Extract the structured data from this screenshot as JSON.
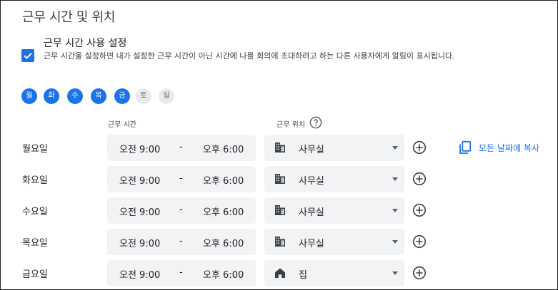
{
  "section": {
    "title": "근무 시간 및 위치"
  },
  "working_hours_toggle": {
    "checked": true,
    "label": "근무 시간 사용 설정",
    "description": "근무 시간을 설정하면 내가 설정한 근무 시간이 아닌 시간에 나를 회의에 초대하려고 하는 다른 사용자에게 알림이 표시됩니다."
  },
  "days": [
    {
      "label": "월",
      "selected": true
    },
    {
      "label": "화",
      "selected": true
    },
    {
      "label": "수",
      "selected": true
    },
    {
      "label": "목",
      "selected": true
    },
    {
      "label": "금",
      "selected": true
    },
    {
      "label": "토",
      "selected": false
    },
    {
      "label": "일",
      "selected": false
    }
  ],
  "columns": {
    "hours": "근무 시간",
    "location": "근무 위치"
  },
  "rows": [
    {
      "day": "월요일",
      "start": "오전 9:00",
      "sep": "-",
      "end": "오후 6:00",
      "location": "사무실",
      "location_icon": "office-building-icon"
    },
    {
      "day": "화요일",
      "start": "오전 9:00",
      "sep": "-",
      "end": "오후 6:00",
      "location": "사무실",
      "location_icon": "office-building-icon"
    },
    {
      "day": "수요일",
      "start": "오전 9:00",
      "sep": "-",
      "end": "오후 6:00",
      "location": "사무실",
      "location_icon": "office-building-icon"
    },
    {
      "day": "목요일",
      "start": "오전 9:00",
      "sep": "-",
      "end": "오후 6:00",
      "location": "사무실",
      "location_icon": "office-building-icon"
    },
    {
      "day": "금요일",
      "start": "오전 9:00",
      "sep": "-",
      "end": "오후 6:00",
      "location": "집",
      "location_icon": "home-icon"
    }
  ],
  "copy_all": {
    "label": "모든 날짜에 복사"
  },
  "colors": {
    "accent": "#1a73e8",
    "field_bg": "#f1f3f4",
    "chip_off": "#e8eaed"
  }
}
